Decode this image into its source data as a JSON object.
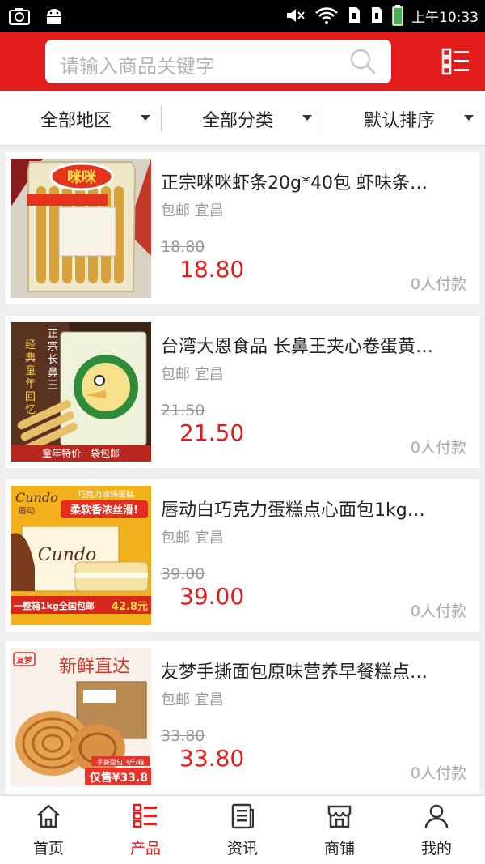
{
  "status_bar": {
    "time": "上午10:33"
  },
  "search": {
    "placeholder": "请输入商品关键字"
  },
  "filters": [
    {
      "label": "全部地区"
    },
    {
      "label": "全部分类"
    },
    {
      "label": "默认排序"
    }
  ],
  "products": [
    {
      "title": "正宗咪咪虾条20g*40包 虾味条…",
      "shipping": "包邮",
      "location": "宜昌",
      "original_price": "18.80",
      "price": "18.80",
      "buyers": "0人付款",
      "image_text": {
        "brand": "咪咪",
        "top": ""
      }
    },
    {
      "title": "台湾大恩食品 长鼻王夹心卷蛋黄…",
      "shipping": "包邮",
      "location": "宜昌",
      "original_price": "21.50",
      "price": "21.50",
      "buyers": "0人付款",
      "image_text": {
        "vertical1": "经典童年回忆",
        "vertical2": "正宗长鼻王",
        "banner": "童年特价一袋包邮"
      }
    },
    {
      "title": "唇动白巧克力蛋糕点心面包1kg…",
      "shipping": "包邮",
      "location": "宜昌",
      "original_price": "39.00",
      "price": "39.00",
      "buyers": "0人付款",
      "image_text": {
        "brand": "Cundo",
        "brand_cn": "唇动",
        "slogan_top": "巧克力涂饰蛋糕",
        "slogan": "柔软香浓丝滑!",
        "banner": "一整箱1kg全国包邮",
        "banner_price": "42.8元"
      }
    },
    {
      "title": "友梦手撕面包原味营养早餐糕点…",
      "shipping": "包邮",
      "location": "宜昌",
      "original_price": "33.80",
      "price": "33.80",
      "buyers": "0人付款",
      "image_text": {
        "brand": "友梦",
        "headline": "新鲜直达",
        "badge": "手撕面包 3斤/箱",
        "sale": "仅售¥33.8"
      }
    }
  ],
  "tabs": [
    {
      "label": "首页",
      "icon": "home-icon",
      "active": false
    },
    {
      "label": "产品",
      "icon": "list-icon",
      "active": true
    },
    {
      "label": "资讯",
      "icon": "news-icon",
      "active": false
    },
    {
      "label": "商铺",
      "icon": "store-icon",
      "active": false
    },
    {
      "label": "我的",
      "icon": "user-icon",
      "active": false
    }
  ],
  "colors": {
    "accent": "#e21b1b",
    "muted": "#999999"
  }
}
